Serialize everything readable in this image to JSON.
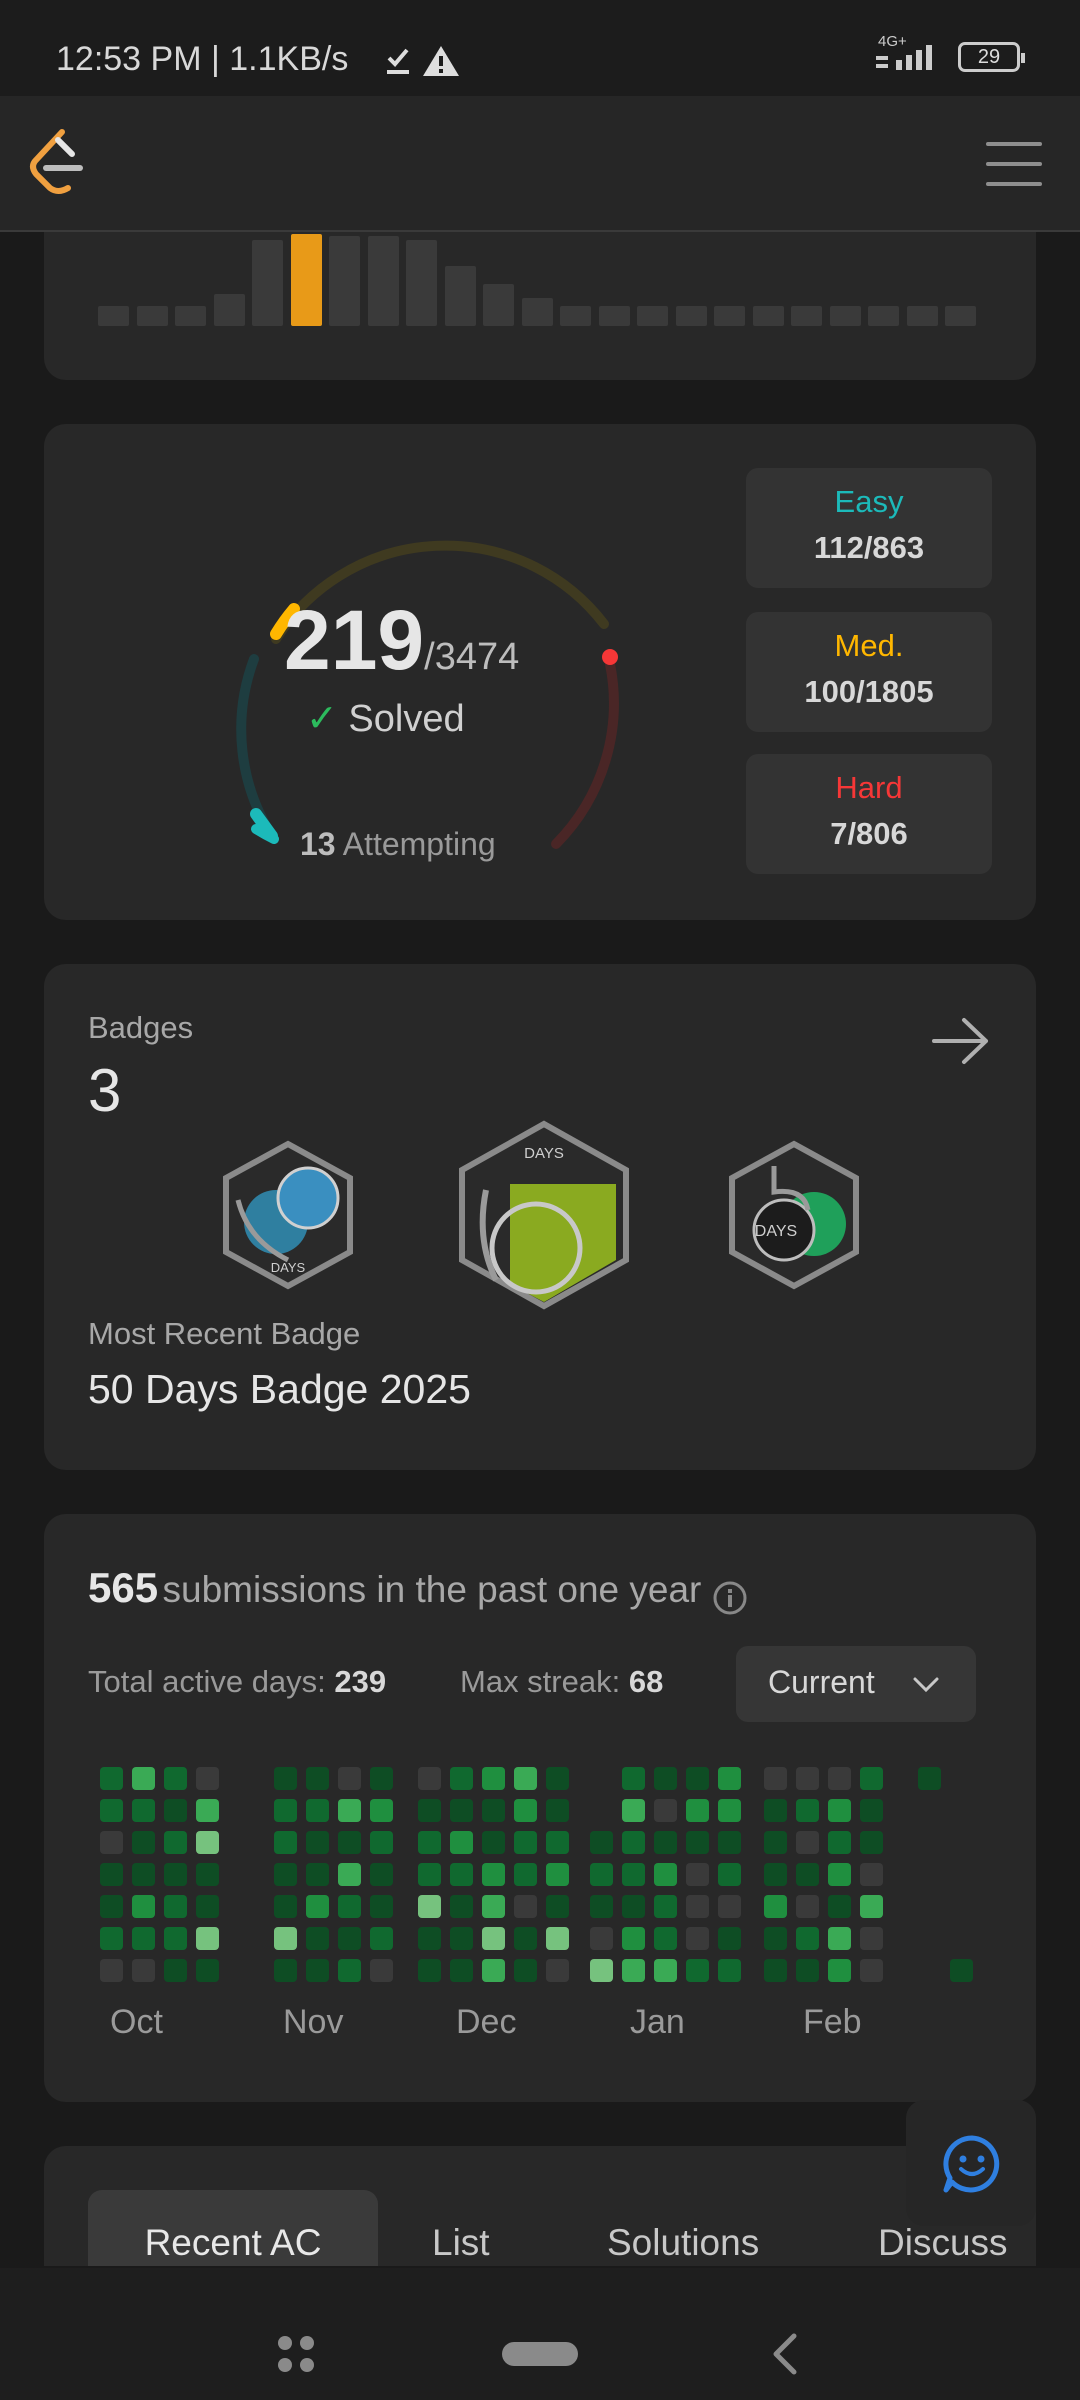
{
  "status_bar": {
    "time_speed": "12:53 PM | 1.1KB/s",
    "network": "4G+",
    "battery": "29"
  },
  "solved": {
    "count": "219",
    "total": "/3474",
    "solved_label": "Solved",
    "attempting_count": "13",
    "attempting_label": "Attempting",
    "levels": [
      {
        "label": "Easy",
        "value": "112/863",
        "color": "#1cbaba"
      },
      {
        "label": "Med.",
        "value": "100/1805",
        "color": "#ffb700"
      },
      {
        "label": "Hard",
        "value": "7/806",
        "color": "#f63737"
      }
    ]
  },
  "badges": {
    "title": "Badges",
    "count": "3",
    "recent_label": "Most Recent Badge",
    "recent_name": "50 Days Badge 2025",
    "badge_text": [
      "DAYS",
      "DAYS",
      "DAYS"
    ]
  },
  "submissions": {
    "count": "565",
    "text": "submissions in the past one year",
    "active_days_label": "Total active days:",
    "active_days": "239",
    "max_streak_label": "Max streak:",
    "max_streak": "68",
    "dropdown": "Current",
    "months": [
      "Oct",
      "Nov",
      "Dec",
      "Jan",
      "Feb"
    ]
  },
  "tabs": [
    "Recent AC",
    "List",
    "Solutions",
    "Discuss"
  ]
}
